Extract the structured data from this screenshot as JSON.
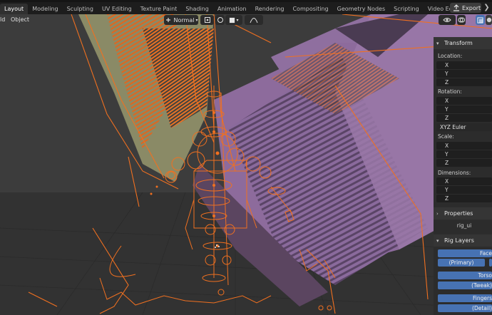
{
  "workspace_tabs": [
    "Layout",
    "Modeling",
    "Sculpting",
    "UV Editing",
    "Texture Paint",
    "Shading",
    "Animation",
    "Rendering",
    "Compositing",
    "Geometry Nodes",
    "Scripting",
    "Video Editing"
  ],
  "active_tab": "Layout",
  "export_label": "Export",
  "export_icon": "export-icon",
  "viewport_header": {
    "menus": [
      "ld",
      "Object"
    ],
    "pivot_mode": "Normal",
    "icons": [
      "transform-orientation-icon",
      "snap-icon",
      "proportional-editing-icon",
      "falloff-curve-icon",
      "gizmo-icon",
      "overlay-icon",
      "xray-icon"
    ]
  },
  "sidebar": {
    "transform": {
      "title": "Transform",
      "location_label": "Location:",
      "location_axes": [
        "X",
        "Y",
        "Z"
      ],
      "rotation_label": "Rotation:",
      "rotation_axes": [
        "X",
        "Y",
        "Z"
      ],
      "rotation_mode": "XYZ Euler",
      "scale_label": "Scale:",
      "scale_axes": [
        "X",
        "Y",
        "Z"
      ],
      "dimensions_label": "Dimensions:",
      "dimensions_axes": [
        "X",
        "Y",
        "Z"
      ]
    },
    "properties": {
      "title": "Properties",
      "value": "rig_ui"
    },
    "rig_layers": {
      "title": "Rig Layers",
      "buttons": [
        "Face",
        "(Primary)",
        "Torso",
        "(Tweak)",
        "Fingers",
        "(Detail)"
      ]
    }
  },
  "colors": {
    "rig_orange": "#f07020",
    "purple_surface": "#8a6a9a",
    "olive_surface": "#8d8d68",
    "button_blue": "#4772b3"
  }
}
